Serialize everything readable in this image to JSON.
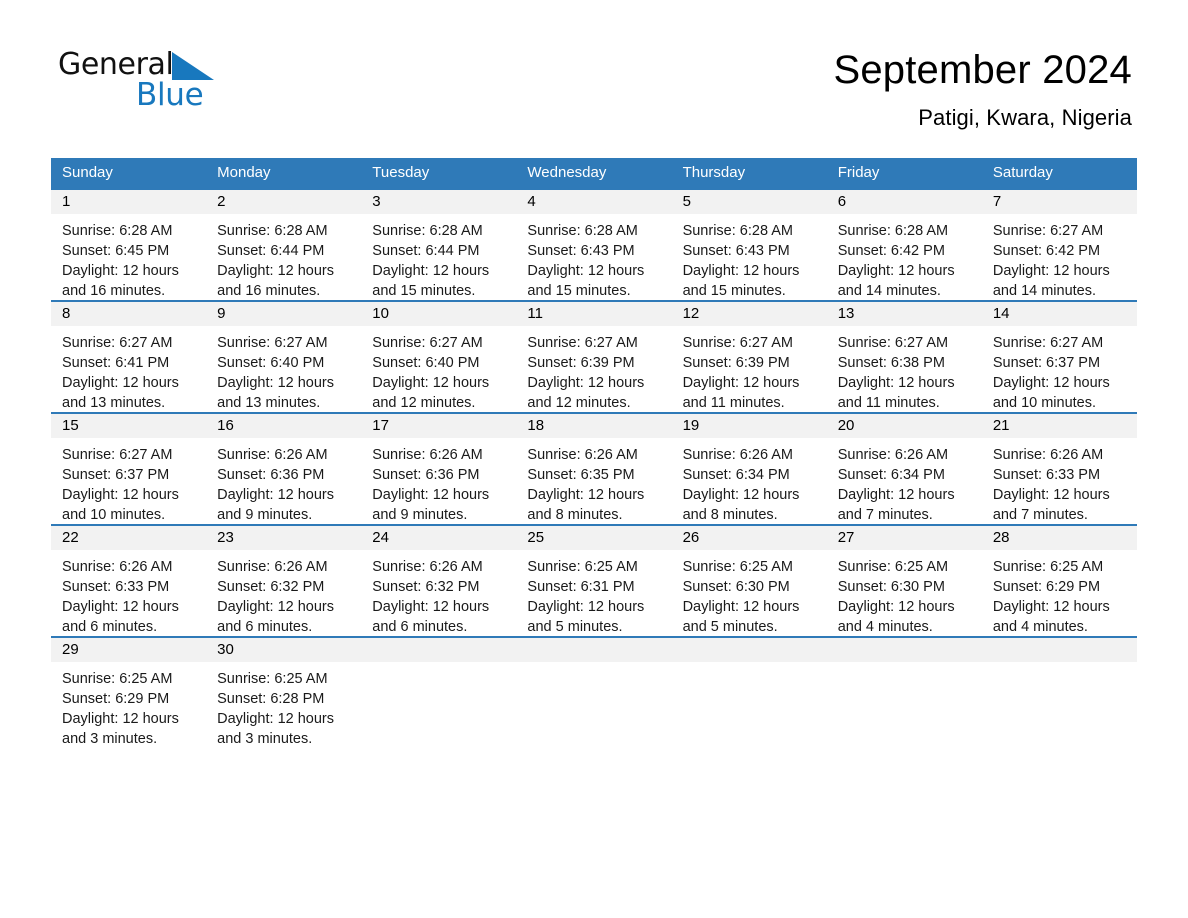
{
  "brand": {
    "name_part1": "General",
    "name_part2": "Blue",
    "triangle_color": "#1878be",
    "logo_icon": "general-blue-logo-icon"
  },
  "header": {
    "month_title": "September 2024",
    "location": "Patigi, Kwara, Nigeria"
  },
  "colors": {
    "header_blue": "#2f7ab8",
    "date_band_gray": "#f2f2f2",
    "text_black": "#000000",
    "brand_blue": "#1878be"
  },
  "calendar": {
    "weekdays": [
      "Sunday",
      "Monday",
      "Tuesday",
      "Wednesday",
      "Thursday",
      "Friday",
      "Saturday"
    ],
    "weeks": [
      [
        {
          "day": "1",
          "sunrise": "Sunrise: 6:28 AM",
          "sunset": "Sunset: 6:45 PM",
          "daylight1": "Daylight: 12 hours",
          "daylight2": "and 16 minutes."
        },
        {
          "day": "2",
          "sunrise": "Sunrise: 6:28 AM",
          "sunset": "Sunset: 6:44 PM",
          "daylight1": "Daylight: 12 hours",
          "daylight2": "and 16 minutes."
        },
        {
          "day": "3",
          "sunrise": "Sunrise: 6:28 AM",
          "sunset": "Sunset: 6:44 PM",
          "daylight1": "Daylight: 12 hours",
          "daylight2": "and 15 minutes."
        },
        {
          "day": "4",
          "sunrise": "Sunrise: 6:28 AM",
          "sunset": "Sunset: 6:43 PM",
          "daylight1": "Daylight: 12 hours",
          "daylight2": "and 15 minutes."
        },
        {
          "day": "5",
          "sunrise": "Sunrise: 6:28 AM",
          "sunset": "Sunset: 6:43 PM",
          "daylight1": "Daylight: 12 hours",
          "daylight2": "and 15 minutes."
        },
        {
          "day": "6",
          "sunrise": "Sunrise: 6:28 AM",
          "sunset": "Sunset: 6:42 PM",
          "daylight1": "Daylight: 12 hours",
          "daylight2": "and 14 minutes."
        },
        {
          "day": "7",
          "sunrise": "Sunrise: 6:27 AM",
          "sunset": "Sunset: 6:42 PM",
          "daylight1": "Daylight: 12 hours",
          "daylight2": "and 14 minutes."
        }
      ],
      [
        {
          "day": "8",
          "sunrise": "Sunrise: 6:27 AM",
          "sunset": "Sunset: 6:41 PM",
          "daylight1": "Daylight: 12 hours",
          "daylight2": "and 13 minutes."
        },
        {
          "day": "9",
          "sunrise": "Sunrise: 6:27 AM",
          "sunset": "Sunset: 6:40 PM",
          "daylight1": "Daylight: 12 hours",
          "daylight2": "and 13 minutes."
        },
        {
          "day": "10",
          "sunrise": "Sunrise: 6:27 AM",
          "sunset": "Sunset: 6:40 PM",
          "daylight1": "Daylight: 12 hours",
          "daylight2": "and 12 minutes."
        },
        {
          "day": "11",
          "sunrise": "Sunrise: 6:27 AM",
          "sunset": "Sunset: 6:39 PM",
          "daylight1": "Daylight: 12 hours",
          "daylight2": "and 12 minutes."
        },
        {
          "day": "12",
          "sunrise": "Sunrise: 6:27 AM",
          "sunset": "Sunset: 6:39 PM",
          "daylight1": "Daylight: 12 hours",
          "daylight2": "and 11 minutes."
        },
        {
          "day": "13",
          "sunrise": "Sunrise: 6:27 AM",
          "sunset": "Sunset: 6:38 PM",
          "daylight1": "Daylight: 12 hours",
          "daylight2": "and 11 minutes."
        },
        {
          "day": "14",
          "sunrise": "Sunrise: 6:27 AM",
          "sunset": "Sunset: 6:37 PM",
          "daylight1": "Daylight: 12 hours",
          "daylight2": "and 10 minutes."
        }
      ],
      [
        {
          "day": "15",
          "sunrise": "Sunrise: 6:27 AM",
          "sunset": "Sunset: 6:37 PM",
          "daylight1": "Daylight: 12 hours",
          "daylight2": "and 10 minutes."
        },
        {
          "day": "16",
          "sunrise": "Sunrise: 6:26 AM",
          "sunset": "Sunset: 6:36 PM",
          "daylight1": "Daylight: 12 hours",
          "daylight2": "and 9 minutes."
        },
        {
          "day": "17",
          "sunrise": "Sunrise: 6:26 AM",
          "sunset": "Sunset: 6:36 PM",
          "daylight1": "Daylight: 12 hours",
          "daylight2": "and 9 minutes."
        },
        {
          "day": "18",
          "sunrise": "Sunrise: 6:26 AM",
          "sunset": "Sunset: 6:35 PM",
          "daylight1": "Daylight: 12 hours",
          "daylight2": "and 8 minutes."
        },
        {
          "day": "19",
          "sunrise": "Sunrise: 6:26 AM",
          "sunset": "Sunset: 6:34 PM",
          "daylight1": "Daylight: 12 hours",
          "daylight2": "and 8 minutes."
        },
        {
          "day": "20",
          "sunrise": "Sunrise: 6:26 AM",
          "sunset": "Sunset: 6:34 PM",
          "daylight1": "Daylight: 12 hours",
          "daylight2": "and 7 minutes."
        },
        {
          "day": "21",
          "sunrise": "Sunrise: 6:26 AM",
          "sunset": "Sunset: 6:33 PM",
          "daylight1": "Daylight: 12 hours",
          "daylight2": "and 7 minutes."
        }
      ],
      [
        {
          "day": "22",
          "sunrise": "Sunrise: 6:26 AM",
          "sunset": "Sunset: 6:33 PM",
          "daylight1": "Daylight: 12 hours",
          "daylight2": "and 6 minutes."
        },
        {
          "day": "23",
          "sunrise": "Sunrise: 6:26 AM",
          "sunset": "Sunset: 6:32 PM",
          "daylight1": "Daylight: 12 hours",
          "daylight2": "and 6 minutes."
        },
        {
          "day": "24",
          "sunrise": "Sunrise: 6:26 AM",
          "sunset": "Sunset: 6:32 PM",
          "daylight1": "Daylight: 12 hours",
          "daylight2": "and 6 minutes."
        },
        {
          "day": "25",
          "sunrise": "Sunrise: 6:25 AM",
          "sunset": "Sunset: 6:31 PM",
          "daylight1": "Daylight: 12 hours",
          "daylight2": "and 5 minutes."
        },
        {
          "day": "26",
          "sunrise": "Sunrise: 6:25 AM",
          "sunset": "Sunset: 6:30 PM",
          "daylight1": "Daylight: 12 hours",
          "daylight2": "and 5 minutes."
        },
        {
          "day": "27",
          "sunrise": "Sunrise: 6:25 AM",
          "sunset": "Sunset: 6:30 PM",
          "daylight1": "Daylight: 12 hours",
          "daylight2": "and 4 minutes."
        },
        {
          "day": "28",
          "sunrise": "Sunrise: 6:25 AM",
          "sunset": "Sunset: 6:29 PM",
          "daylight1": "Daylight: 12 hours",
          "daylight2": "and 4 minutes."
        }
      ],
      [
        {
          "day": "29",
          "sunrise": "Sunrise: 6:25 AM",
          "sunset": "Sunset: 6:29 PM",
          "daylight1": "Daylight: 12 hours",
          "daylight2": "and 3 minutes."
        },
        {
          "day": "30",
          "sunrise": "Sunrise: 6:25 AM",
          "sunset": "Sunset: 6:28 PM",
          "daylight1": "Daylight: 12 hours",
          "daylight2": "and 3 minutes."
        },
        {
          "day": "",
          "sunrise": "",
          "sunset": "",
          "daylight1": "",
          "daylight2": ""
        },
        {
          "day": "",
          "sunrise": "",
          "sunset": "",
          "daylight1": "",
          "daylight2": ""
        },
        {
          "day": "",
          "sunrise": "",
          "sunset": "",
          "daylight1": "",
          "daylight2": ""
        },
        {
          "day": "",
          "sunrise": "",
          "sunset": "",
          "daylight1": "",
          "daylight2": ""
        },
        {
          "day": "",
          "sunrise": "",
          "sunset": "",
          "daylight1": "",
          "daylight2": ""
        }
      ]
    ]
  }
}
